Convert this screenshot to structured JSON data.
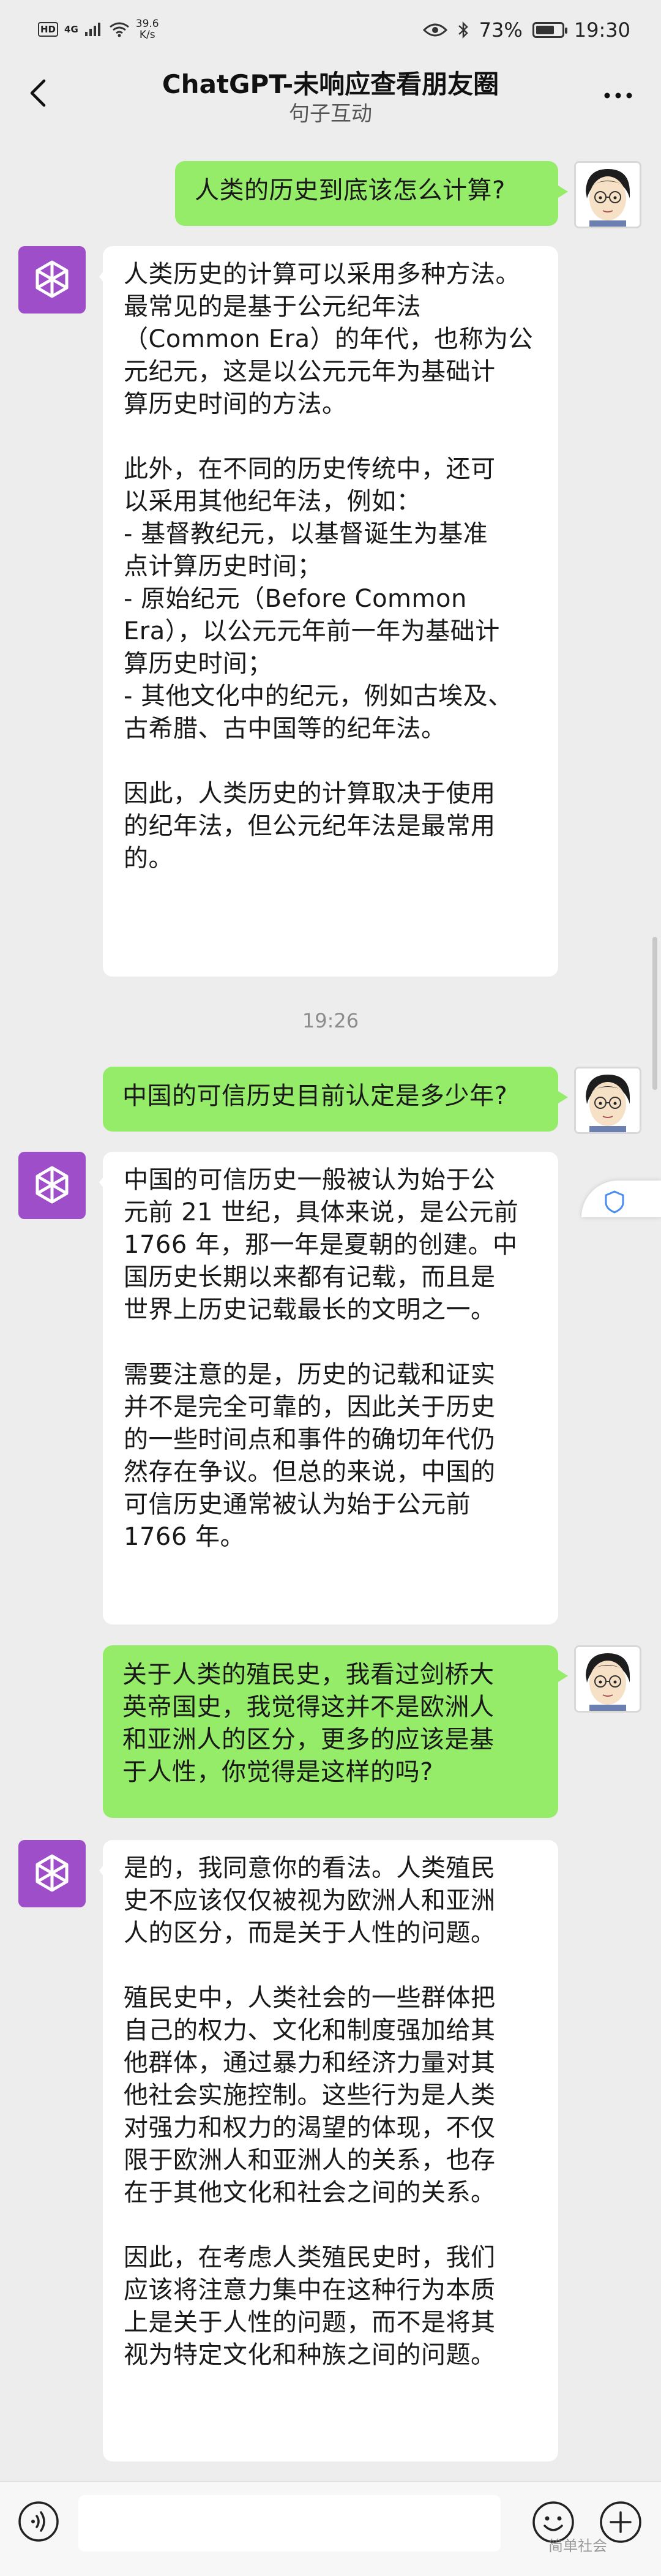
{
  "status_bar": {
    "network_badge": "HD",
    "signal_label": "4G",
    "speed_value": "39.6",
    "speed_unit": "K/s",
    "battery_percent": "73%",
    "battery_level": 0.73,
    "time": "19:30"
  },
  "header": {
    "title": "ChatGPT-未响应查看朋友圈",
    "subtitle": "句子互动",
    "back_icon": "chevron-left-icon",
    "more_icon": "more-dots-icon"
  },
  "messages": [
    {
      "role": "user",
      "text": "人类的历史到底该怎么计算?"
    },
    {
      "role": "bot",
      "text": "人类历史的计算可以采用多种方法。\n最常见的是基于公元纪年法\n（Common Era）的年代，也称为公\n元纪元，这是以公元元年为基础计\n算历史时间的方法。\n\n此外，在不同的历史传统中，还可\n以采用其他纪年法，例如：\n- 基督教纪元，以基督诞生为基准\n点计算历史时间；\n- 原始纪元（Before Common\nEra），以公元元年前一年为基础计\n算历史时间；\n- 其他文化中的纪元，例如古埃及、\n古希腊、古中国等的纪年法。\n\n因此，人类历史的计算取决于使用\n的纪年法，但公元纪年法是最常用\n的。"
    },
    {
      "role": "user",
      "text": "中国的可信历史目前认定是多少年?"
    },
    {
      "role": "bot",
      "text": "中国的可信历史一般被认为始于公\n元前 21 世纪，具体来说，是公元前\n1766 年，那一年是夏朝的创建。中\n国历史长期以来都有记载，而且是\n世界上历史记载最长的文明之一。\n\n需要注意的是，历史的记载和证实\n并不是完全可靠的，因此关于历史\n的一些时间点和事件的确切年代仍\n然存在争议。但总的来说，中国的\n可信历史通常被认为始于公元前\n1766 年。"
    },
    {
      "role": "user",
      "text": "关于人类的殖民史，我看过剑桥大\n英帝国史，我觉得这并不是欧洲人\n和亚洲人的区分，更多的应该是基\n于人性，你觉得是这样的吗?"
    },
    {
      "role": "bot",
      "text": "是的，我同意你的看法。人类殖民\n史不应该仅仅被视为欧洲人和亚洲\n人的区分，而是关于人性的问题。\n\n殖民史中，人类社会的一些群体把\n自己的权力、文化和制度强加给其\n他群体，通过暴力和经济力量对其\n他社会实施控制。这些行为是人类\n对强力和权力的渴望的体现，不仅\n限于欧洲人和亚洲人的关系，也存\n在于其他文化和社会之间的关系。\n\n因此，在考虑人类殖民史时，我们\n应该将注意力集中在这种行为本质\n上是关于人性的问题，而不是将其\n视为特定文化和种族之间的问题。"
    }
  ],
  "timestamp": "19:26",
  "input_bar": {
    "voice_icon": "voice-icon",
    "emoji_icon": "emoji-icon",
    "plus_icon": "plus-icon"
  },
  "watermark": "简单社会"
}
